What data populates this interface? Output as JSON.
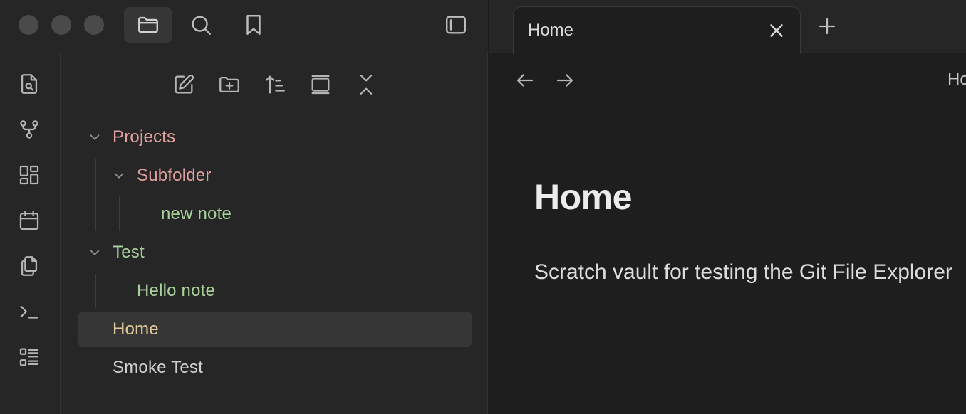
{
  "sidebar": {
    "tree": [
      {
        "label": "Projects",
        "kind": "folder"
      },
      {
        "label": "Subfolder",
        "kind": "folder"
      },
      {
        "label": "new note",
        "kind": "file"
      },
      {
        "label": "Test",
        "kind": "folder"
      },
      {
        "label": "Hello note",
        "kind": "file"
      },
      {
        "label": "Home",
        "kind": "file",
        "selected": true
      },
      {
        "label": "Smoke Test",
        "kind": "file"
      }
    ]
  },
  "tabs": [
    {
      "title": "Home"
    }
  ],
  "view": {
    "header_title": "Home",
    "heading": "Home",
    "paragraph": "Scratch vault for testing the Git File Explorer"
  },
  "colors": {
    "folder": "#e0a09e",
    "file_modified": "#a9d19c",
    "file_selected": "#e3c99b",
    "background": "#1e1e1e",
    "sidebar": "#262626"
  }
}
